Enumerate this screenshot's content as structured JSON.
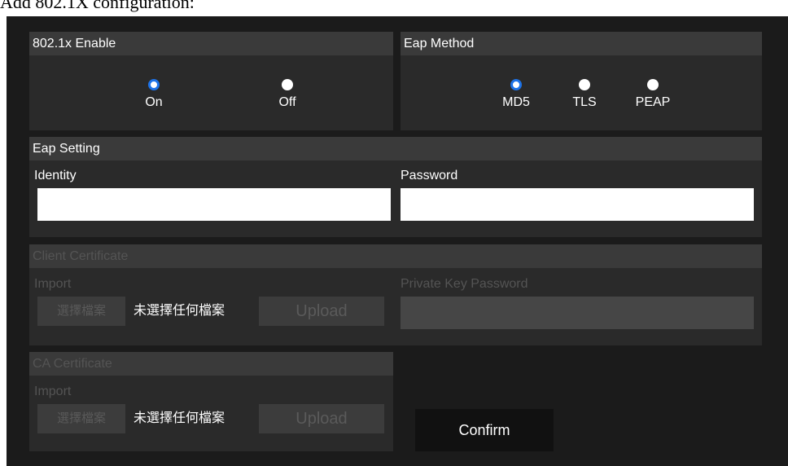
{
  "caption": "Add 802.1X configuration:",
  "enable_panel": {
    "title": "802.1x Enable",
    "options": [
      {
        "label": "On",
        "checked": true
      },
      {
        "label": "Off",
        "checked": false
      }
    ]
  },
  "eap_method_panel": {
    "title": "Eap Method",
    "options": [
      {
        "label": "MD5",
        "checked": true
      },
      {
        "label": "TLS",
        "checked": false
      },
      {
        "label": "PEAP",
        "checked": false
      }
    ]
  },
  "eap_setting": {
    "title": "Eap Setting",
    "identity_label": "Identity",
    "identity_value": "",
    "password_label": "Password",
    "password_value": ""
  },
  "client_certificate": {
    "title": "Client Certificate",
    "import_label": "Import",
    "choose_file_label": "選擇檔案",
    "file_status": "未選擇任何檔案",
    "upload_label": "Upload",
    "private_key_label": "Private Key Password",
    "private_key_value": ""
  },
  "ca_certificate": {
    "title": "CA Certificate",
    "import_label": "Import",
    "choose_file_label": "選擇檔案",
    "file_status": "未選擇任何檔案",
    "upload_label": "Upload"
  },
  "confirm_label": "Confirm",
  "colors": {
    "radio_checked": "#1e73e8",
    "panel_bg": "#2a2a2a",
    "header_bg": "#3a3a3a",
    "frame_bg": "#1b1b1b"
  }
}
